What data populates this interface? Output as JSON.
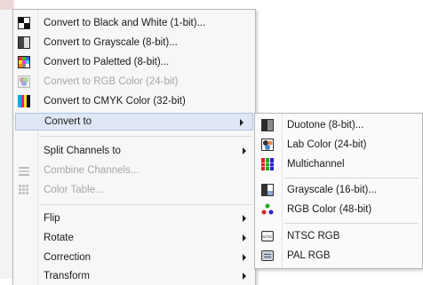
{
  "main_menu": {
    "items": [
      {
        "label": "Convert to Black and White (1-bit)...",
        "icon": "black-white-icon"
      },
      {
        "label": "Convert to Grayscale (8-bit)...",
        "icon": "grayscale-icon"
      },
      {
        "label": "Convert to Paletted (8-bit)...",
        "icon": "paletted-icon"
      },
      {
        "label": "Convert to RGB Color (24-bit)",
        "icon": "rgb-color-icon"
      },
      {
        "label": "Convert to CMYK Color (32-bit)",
        "icon": "cmyk-color-icon"
      },
      {
        "label": "Convert to"
      },
      {
        "label": "Split Channels to"
      },
      {
        "label": "Combine Channels...",
        "icon": "combine-channels-icon"
      },
      {
        "label": "Color Table...",
        "icon": "color-table-icon"
      },
      {
        "label": "Flip"
      },
      {
        "label": "Rotate"
      },
      {
        "label": "Correction"
      },
      {
        "label": "Transform"
      }
    ]
  },
  "sub_menu": {
    "items": [
      {
        "label": "Duotone (8-bit)...",
        "icon": "duotone-icon"
      },
      {
        "label": "Lab Color (24-bit)",
        "icon": "lab-color-icon"
      },
      {
        "label": "Multichannel",
        "icon": "multichannel-icon"
      },
      {
        "label": "Grayscale (16-bit)...",
        "icon": "grayscale-16-icon"
      },
      {
        "label": "RGB Color (48-bit)",
        "icon": "rgb-48-icon"
      },
      {
        "label": "NTSC RGB",
        "icon": "ntsc-icon",
        "badge": "NTSC"
      },
      {
        "label": "PAL RGB",
        "icon": "pal-icon"
      }
    ]
  },
  "colors": {
    "menu_bg": "#f7f7f7",
    "highlight_bg": "#dfe7f5",
    "highlight_border": "#aec4e8",
    "disabled_text": "#a6a6a6"
  }
}
